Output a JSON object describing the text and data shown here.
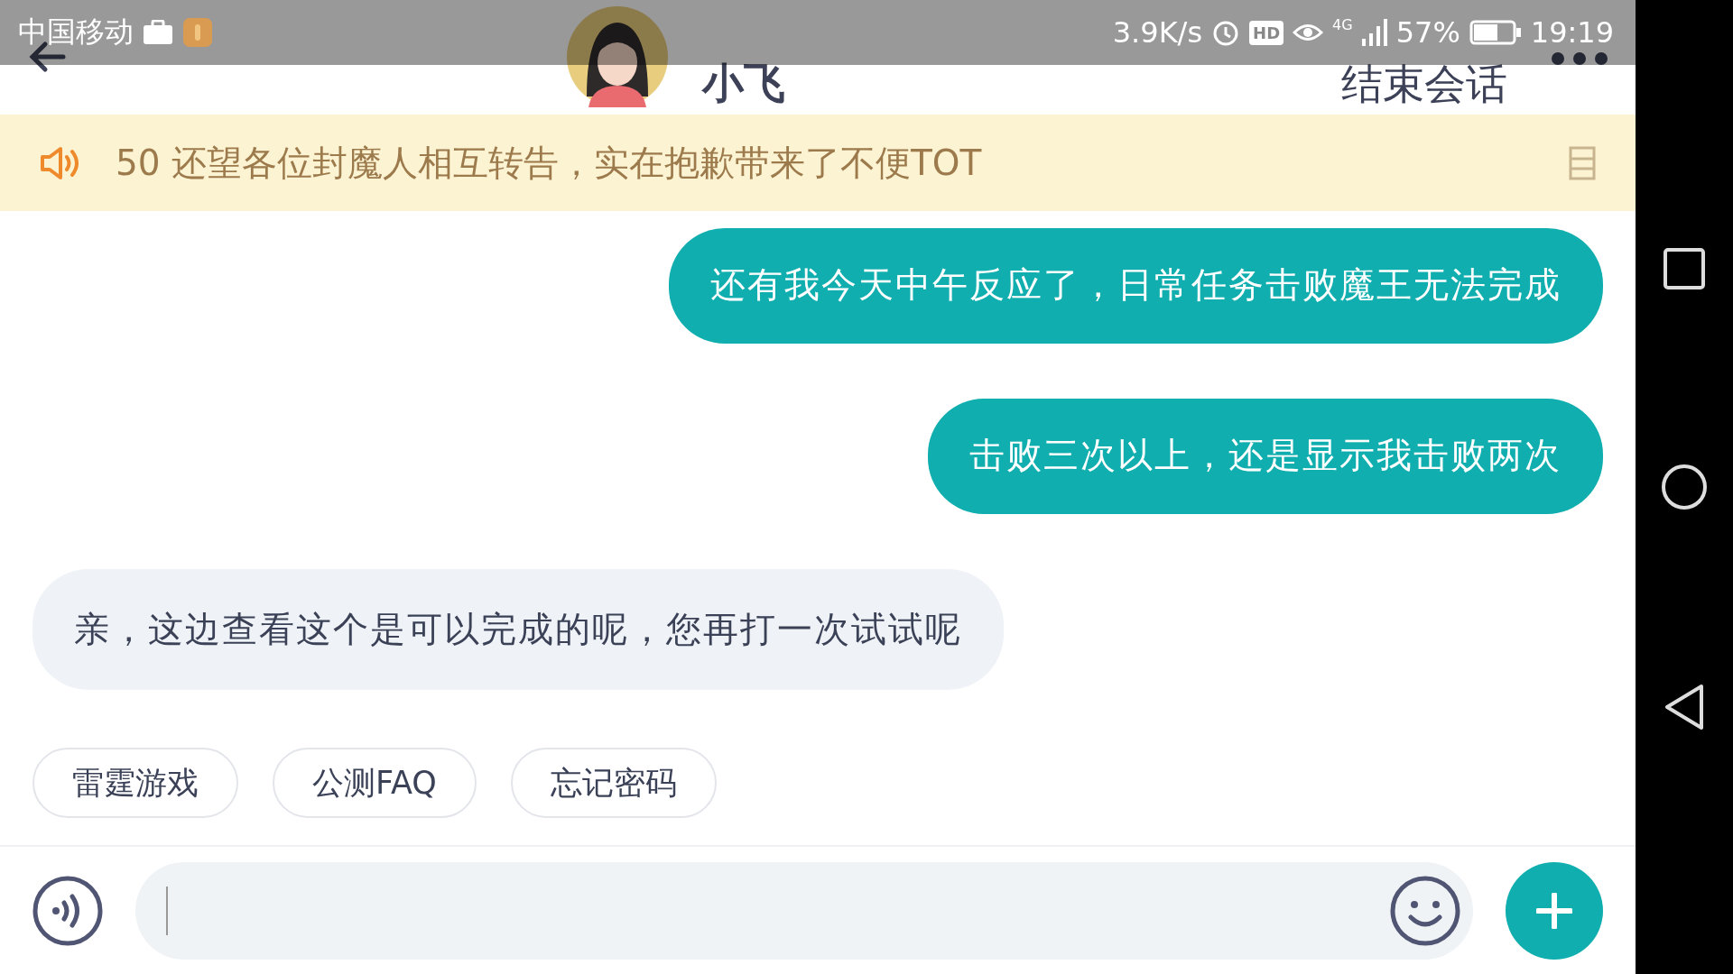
{
  "status_bar": {
    "carrier": "中国移动",
    "speed": "3.9K/s",
    "hd": "HD",
    "network": "4G",
    "battery": "57%",
    "time": "19:19"
  },
  "header": {
    "title": "小飞",
    "end_button": "结束会话"
  },
  "notice": {
    "text": "50 还望各位封魔人相互转告，实在抱歉带来了不便TOT"
  },
  "messages": [
    {
      "kind": "sent",
      "text": "还有我今天中午反应了，日常任务击败魔王无法完成"
    },
    {
      "kind": "sent",
      "text": "击败三次以上，还是显示我击败两次"
    },
    {
      "kind": "received",
      "text": "亲，这边查看这个是可以完成的呢，您再打一次试试呢"
    }
  ],
  "quick_replies": [
    "雷霆游戏",
    "公测FAQ",
    "忘记密码"
  ]
}
